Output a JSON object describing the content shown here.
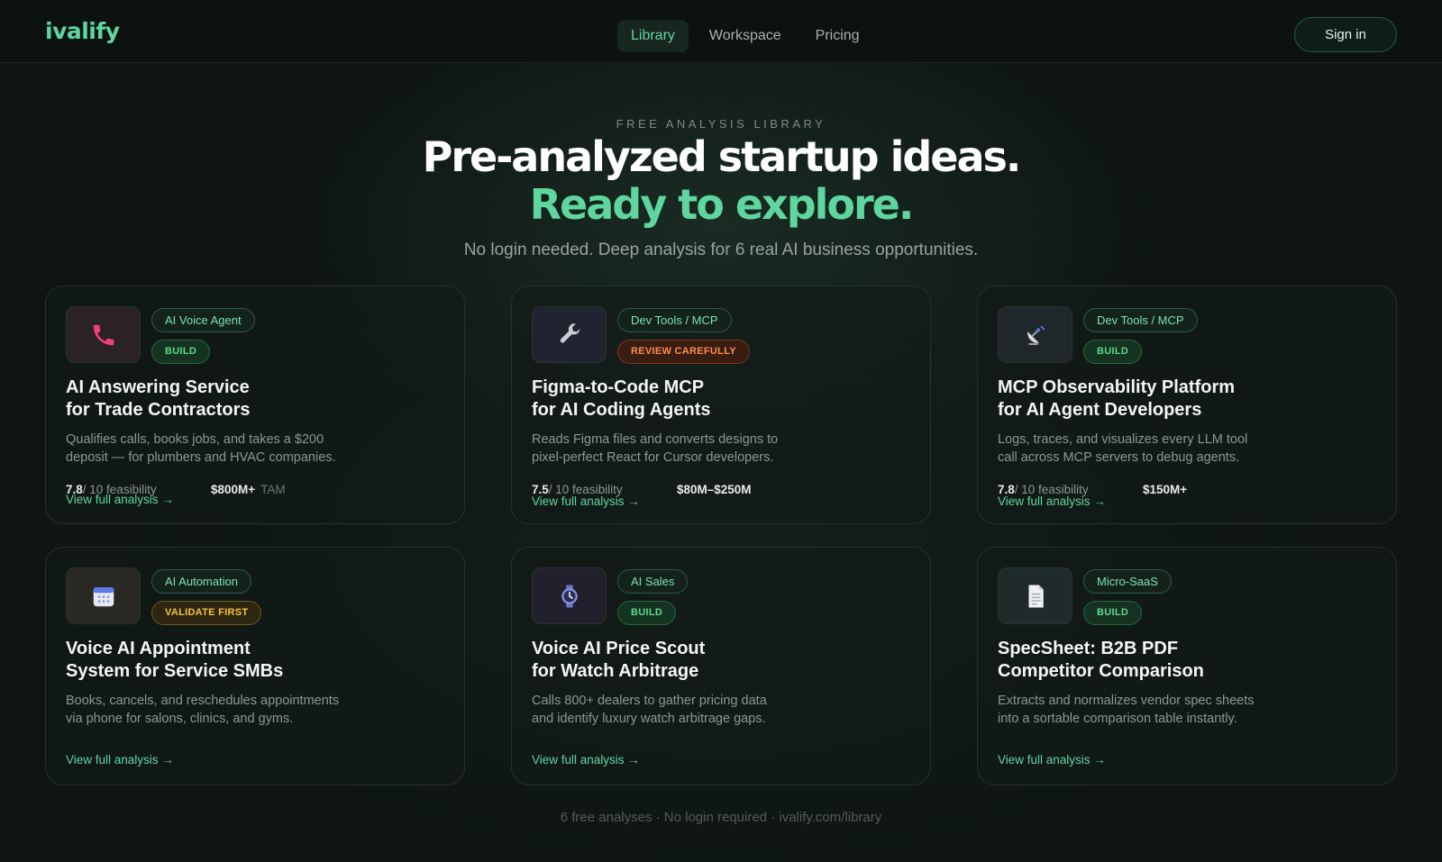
{
  "nav": {
    "logo": "ivalify",
    "links": [
      "Library",
      "Workspace",
      "Pricing"
    ],
    "signin": "Sign in"
  },
  "hero": {
    "eyebrow": "FREE ANALYSIS LIBRARY",
    "line1": "Pre-analyzed startup ideas.",
    "line2": "Ready to explore.",
    "subtitle": "No login needed. Deep analysis for 6 real AI business opportunities."
  },
  "cards": [
    {
      "icon": "phone-icon",
      "category": "AI Voice Agent",
      "verdict": "BUILD",
      "title1": "AI Answering Service",
      "title2": "for Trade Contractors",
      "desc1": "Qualifies calls, books jobs, and takes a $200",
      "desc2": "deposit — for plumbers and HVAC companies.",
      "score": "7.8",
      "score_suffix": "/ 10 feasibility",
      "tam": "$800M+",
      "tam_label": "TAM",
      "link": "View full analysis →"
    },
    {
      "icon": "wrench-icon",
      "category": "Dev Tools / MCP",
      "verdict": "REVIEW CAREFULLY",
      "title1": "Figma-to-Code MCP",
      "title2": "for AI Coding Agents",
      "desc1": "Reads Figma files and converts designs to",
      "desc2": "pixel-perfect React for Cursor developers.",
      "score": "7.5",
      "score_suffix": "/ 10 feasibility",
      "tam": "$80M–$250M",
      "link": "View full analysis →"
    },
    {
      "icon": "satellite-dish-icon",
      "category": "Dev Tools / MCP",
      "verdict": "BUILD",
      "title1": "MCP Observability Platform",
      "title2": "for AI Agent Developers",
      "desc1": "Logs, traces, and visualizes every LLM tool",
      "desc2": "call across MCP servers to debug agents.",
      "score": "7.8",
      "score_suffix": "/ 10 feasibility",
      "tam": "$150M+",
      "link": "View full analysis →"
    },
    {
      "icon": "calendar-icon",
      "category": "AI Automation",
      "verdict": "VALIDATE FIRST",
      "title1": "Voice AI Appointment",
      "title2": "System for Service SMBs",
      "desc1": "Books, cancels, and reschedules appointments",
      "desc2": "via phone for salons, clinics, and gyms.",
      "link": "View full analysis →"
    },
    {
      "icon": "watch-icon",
      "category": "AI Sales",
      "verdict": "BUILD",
      "title1": "Voice AI Price Scout",
      "title2": "for Watch Arbitrage",
      "desc1": "Calls 800+ dealers to gather pricing data",
      "desc2": "and identify luxury watch arbitrage gaps.",
      "link": "View full analysis →"
    },
    {
      "icon": "document-icon",
      "category": "Micro-SaaS",
      "verdict": "BUILD",
      "title1": "SpecSheet: B2B PDF",
      "title2": "Competitor Comparison",
      "desc1": "Extracts and normalizes vendor spec sheets",
      "desc2": "into a sortable comparison table instantly.",
      "link": "View full analysis →"
    }
  ],
  "footer": "6 free analyses · No login required · ivalify.com/library",
  "colors": {
    "accent": "#5fd6a0",
    "build": "#5fd68a",
    "review": "#ff8d4d",
    "validate": "#f2c53d"
  }
}
